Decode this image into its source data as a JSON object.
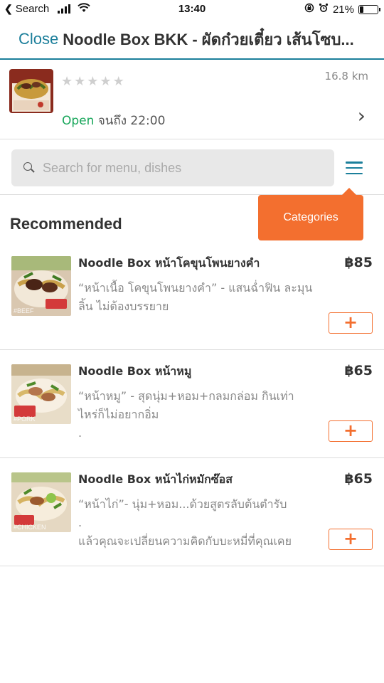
{
  "status_bar": {
    "back_label": "Search",
    "time": "13:40",
    "battery": "21%",
    "battery_level": 0.21
  },
  "header": {
    "close_label": "Close",
    "title": "Noodle Box BKK - ผัดก๋วยเตี๋ยว เส้นโซบ..."
  },
  "restaurant": {
    "rating_stars": 5,
    "rating_filled": 0,
    "distance": "16.8 km",
    "open_status": "Open",
    "open_until": "จนถึง 22:00"
  },
  "search": {
    "placeholder": "Search for menu, dishes",
    "value": ""
  },
  "categories_tooltip": "Categories",
  "section_title": "Recommended",
  "items": [
    {
      "name": "Noodle Box หน้าโคขุนโพนยางคำ",
      "price": "฿85",
      "desc": "“หน้าเนื้อ โคขุนโพนยางคำ” -  แสนฉ่ำฟิน ละมุนลิ้น ไม่ต้องบรรยาย",
      "tag": "#BEEF",
      "add_label": "+"
    },
    {
      "name": "Noodle Box หน้าหมู",
      "price": "฿65",
      "desc": "“หน้าหมู” - สุดนุ่ม+หอม+กลมกล่อม กินเท่าไหร่ก็ไม่อยากอิ่ม\n.",
      "tag": "#PORK",
      "add_label": "+"
    },
    {
      "name": "Noodle Box หน้าไก่หมักซ๊อส",
      "price": "฿65",
      "desc": "“หน้าไก่”- นุ่ม+หอม...ด้วยสูตรลับต้นตำรับ\n.\nแล้วคุณจะเปลี่ยนความคิดกับบะหมี่ที่คุณเคย",
      "tag": "#CHICKEN",
      "add_label": "+"
    }
  ],
  "colors": {
    "accent": "#1c7f9b",
    "orange": "#f36f2f",
    "open_green": "#17a65a"
  }
}
